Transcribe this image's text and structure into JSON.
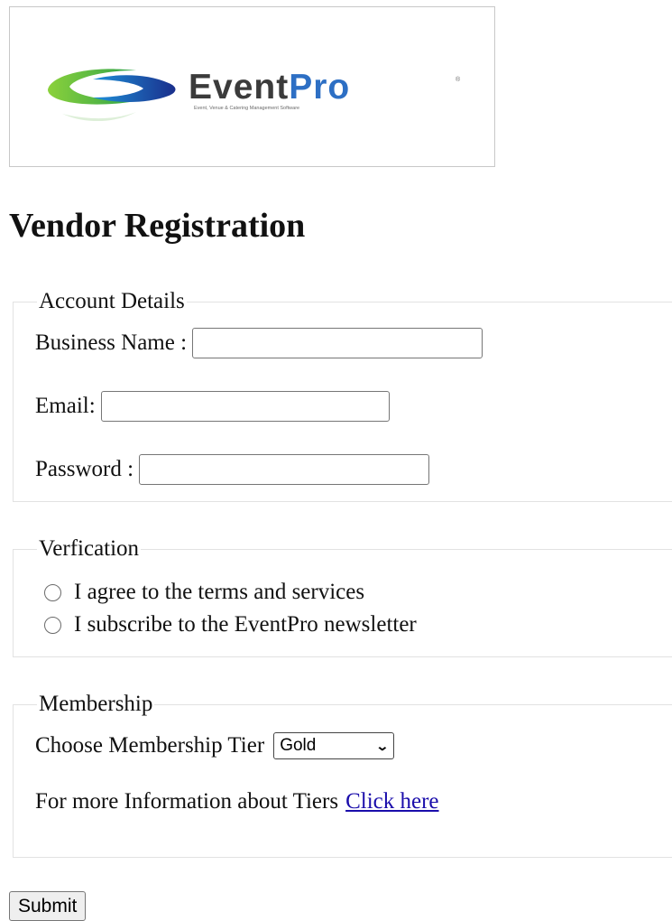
{
  "logo": {
    "wordmark_part1": "Event",
    "wordmark_part2": "Pro",
    "tagline": "Event, Venue & Catering Management Software",
    "colors": {
      "dark": "#3b3b3b",
      "blue": "#2d6fc4",
      "green": "#4cb547",
      "navy": "#1e3a8a"
    }
  },
  "page_title": "Vendor Registration",
  "account": {
    "legend": "Account Details",
    "business_name_label": "Business Name :",
    "business_name_value": "",
    "email_label": "Email:",
    "email_value": "",
    "password_label": "Password :",
    "password_value": ""
  },
  "verification": {
    "legend": "Verfication",
    "options": [
      {
        "label": "I agree to the terms and services",
        "checked": false
      },
      {
        "label": "I subscribe to the EventPro newsletter",
        "checked": false
      }
    ]
  },
  "membership": {
    "legend": "Membership",
    "tier_label": "Choose Membership Tier",
    "tier_selected": "Gold",
    "info_text": "For more Information about Tiers",
    "info_link": "Click here"
  },
  "submit_label": "Submit"
}
